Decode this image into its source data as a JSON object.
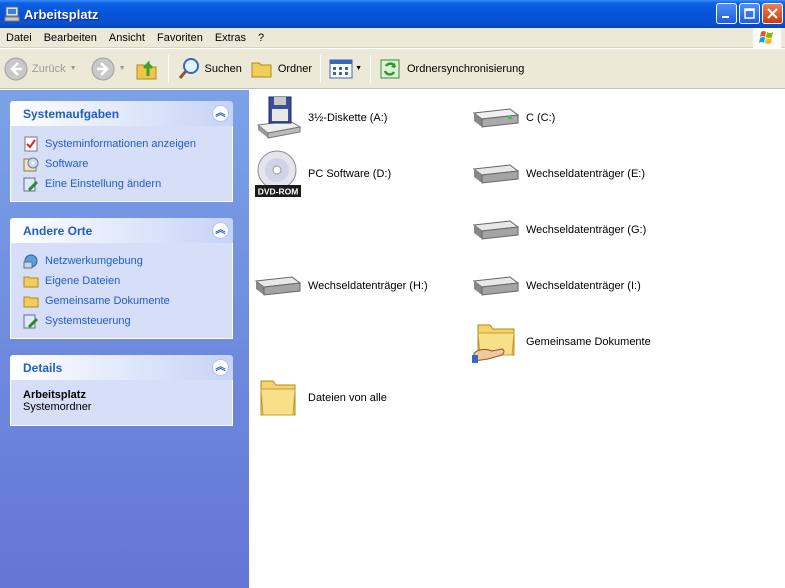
{
  "window": {
    "title": "Arbeitsplatz"
  },
  "menu": [
    "Datei",
    "Bearbeiten",
    "Ansicht",
    "Favoriten",
    "Extras",
    "?"
  ],
  "toolbar": {
    "back": "Zurück",
    "search": "Suchen",
    "folders": "Ordner",
    "sync": "Ordnersynchronisierung"
  },
  "panels": {
    "system_tasks": {
      "title": "Systemaufgaben",
      "links": [
        "Systeminformationen anzeigen",
        "Software",
        "Eine Einstellung ändern"
      ]
    },
    "other_places": {
      "title": "Andere Orte",
      "links": [
        "Netzwerkumgebung",
        "Eigene Dateien",
        "Gemeinsame Dokumente",
        "Systemsteuerung"
      ]
    },
    "details": {
      "title": "Details",
      "name": "Arbeitsplatz",
      "type": "Systemordner"
    }
  },
  "drives": {
    "floppy": "3½-Diskette (A:)",
    "c": "C (C:)",
    "dvd": "PC Software (D:)",
    "e": "Wechseldatenträger (E:)",
    "g": "Wechseldatenträger (G:)",
    "h": "Wechseldatenträger (H:)",
    "i": "Wechseldatenträger (I:)",
    "shared_docs": "Gemeinsame Dokumente",
    "all_files": "Dateien von alle",
    "dvd_badge": "DVD-ROM"
  },
  "icons": {
    "app": "computer-icon",
    "minimize": "minimize-icon",
    "maximize": "maximize-icon",
    "close": "close-icon",
    "back": "back-arrow-icon",
    "forward": "forward-arrow-icon",
    "up": "folder-up-icon",
    "search": "magnifier-icon",
    "folders": "folder-tree-icon",
    "views": "views-icon",
    "sync": "sync-icon"
  },
  "colors": {
    "accent": "#215dc6",
    "titlebar": "#0754d8",
    "panel_body": "#d6dff7"
  }
}
